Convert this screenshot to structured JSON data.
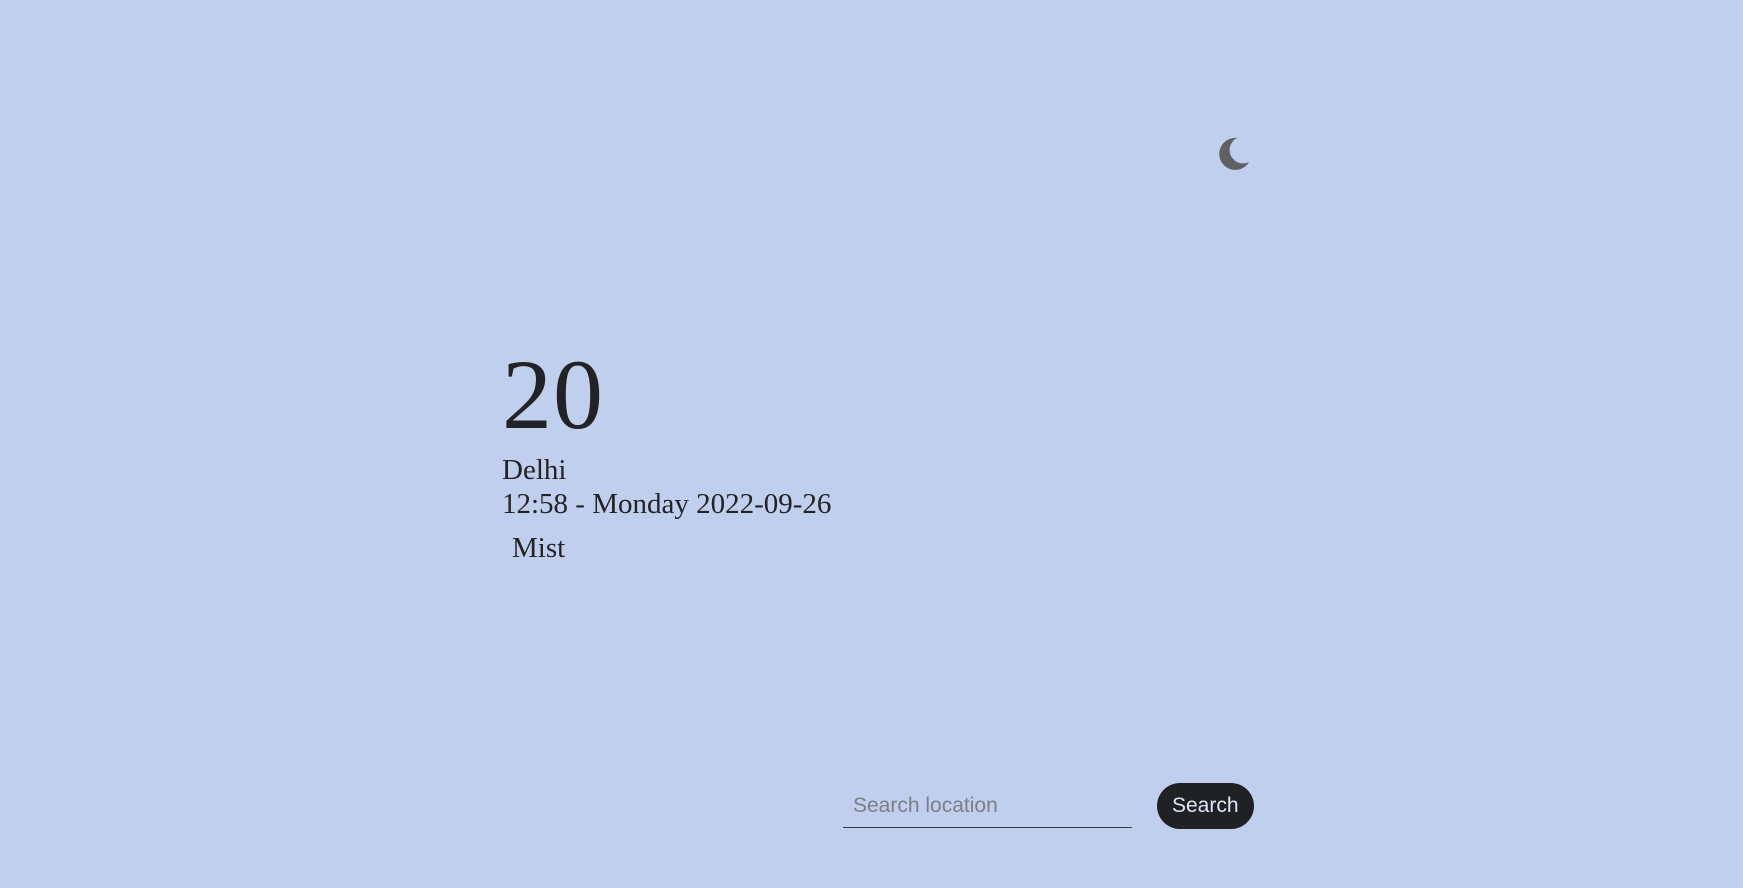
{
  "theme_toggle": {
    "icon": "moon-icon",
    "icon_color": "#5f6063"
  },
  "weather": {
    "temperature": "20",
    "city": "Delhi",
    "datetime": "12:58 - Monday 2022-09-26",
    "condition": "Mist"
  },
  "search": {
    "placeholder": "Search location",
    "value": "",
    "button_label": "Search"
  },
  "colors": {
    "background": "#c0cfee",
    "text": "#222326",
    "button_bg": "#202124",
    "button_text": "#dfe6f8"
  }
}
